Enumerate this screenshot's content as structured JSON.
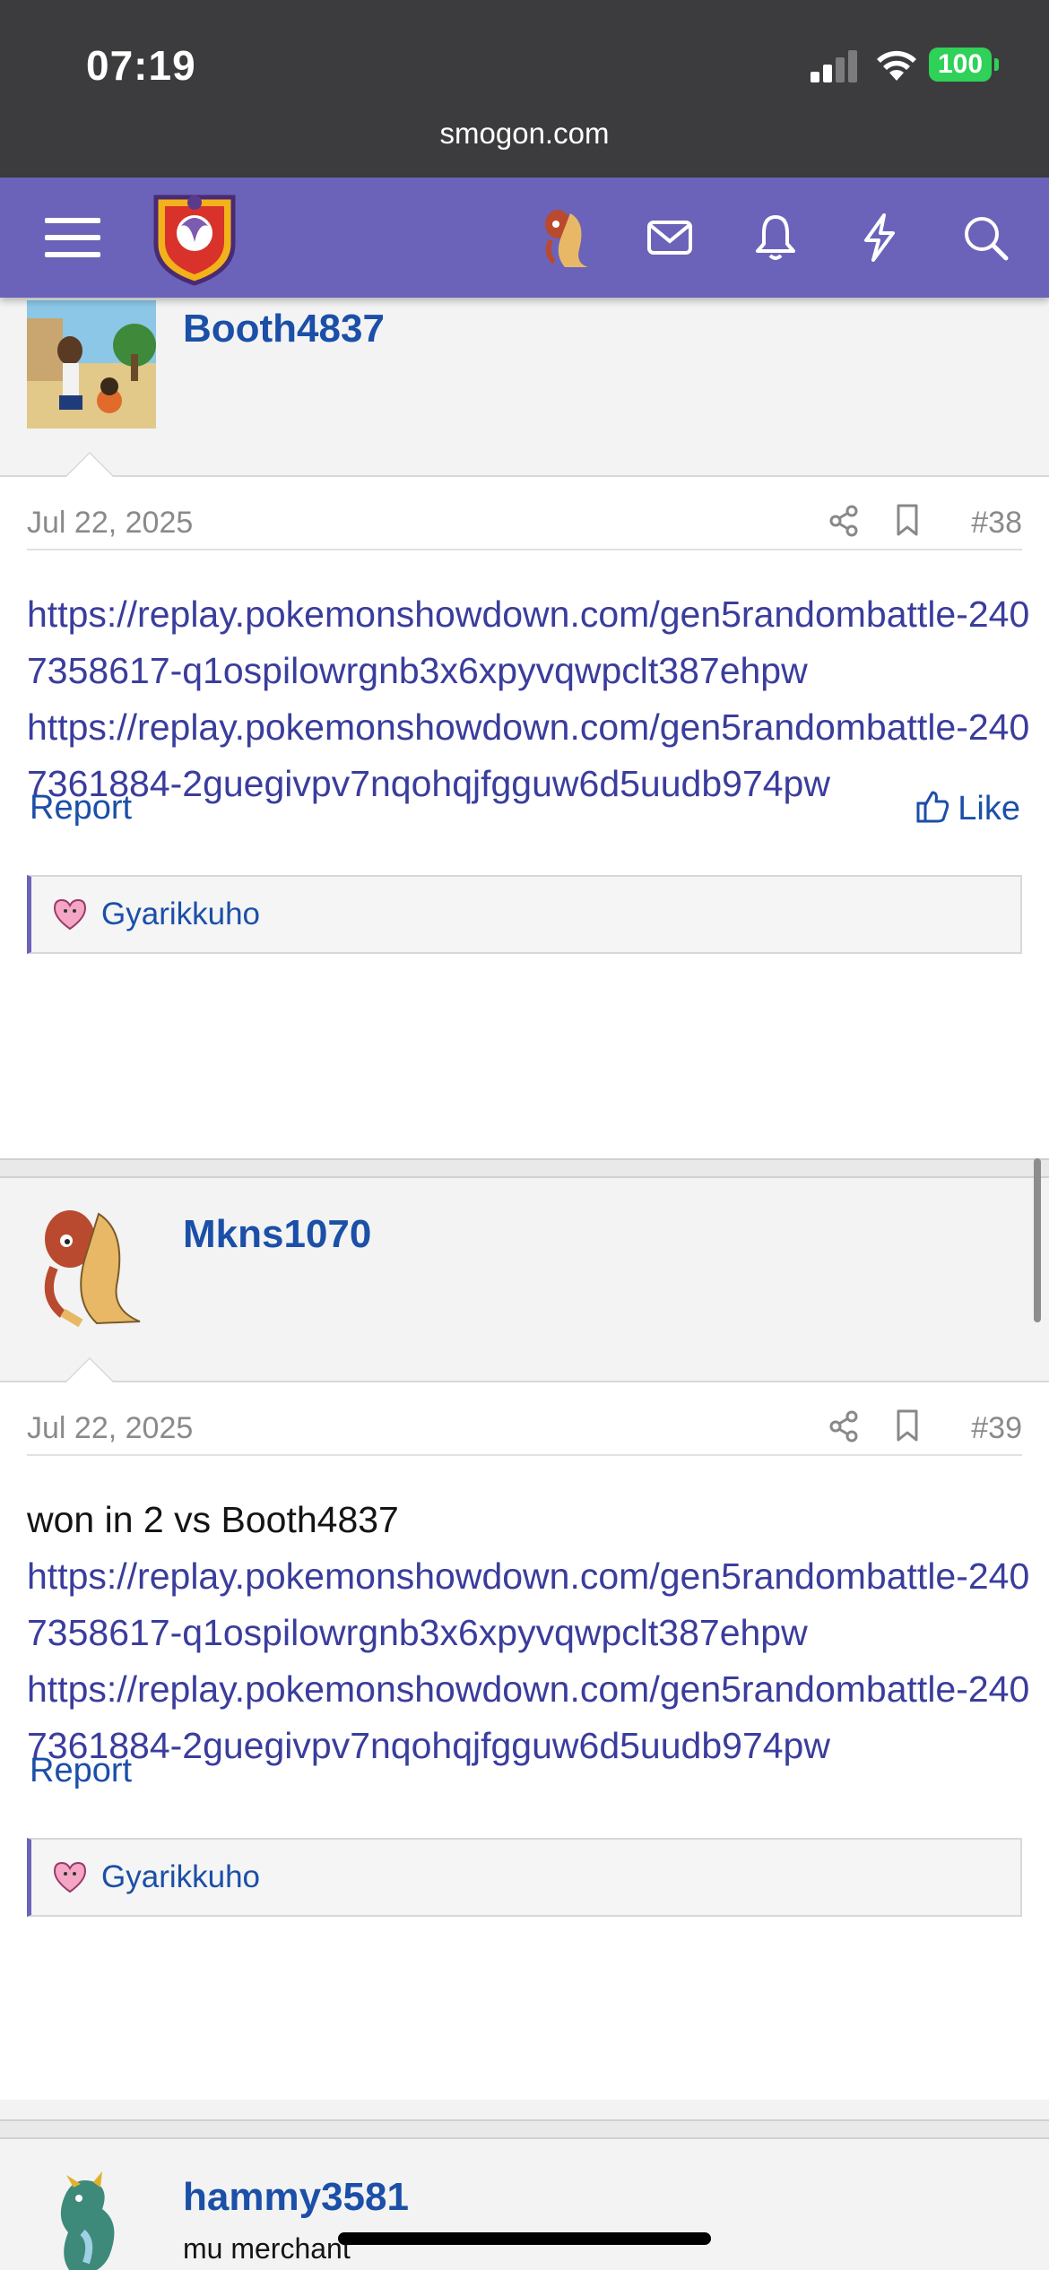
{
  "status_bar": {
    "time": "07:19",
    "battery": "100"
  },
  "browser": {
    "url": "smogon.com"
  },
  "colors": {
    "nav": "#6b63b9",
    "link": "#3a3d9c",
    "username": "#1b4fa8"
  },
  "posts": [
    {
      "author": "Booth4837",
      "date": "Jul 22, 2025",
      "number": "#38",
      "intro": "",
      "links": [
        "https://replay.pokemonshowdown.com/gen5randombattle-2407358617-q1ospilowrgnb3x6xpyvqwpclt387ehpw",
        "https://replay.pokemonshowdown.com/gen5randombattle-2407361884-2guegivpv7nqohqjfgguw6d5uudb974pw"
      ],
      "report": "Report",
      "like": "Like",
      "reaction_user": "Gyarikkuho"
    },
    {
      "author": "Mkns1070",
      "date": "Jul 22, 2025",
      "number": "#39",
      "intro": "won in 2 vs Booth4837",
      "links": [
        "https://replay.pokemonshowdown.com/gen5randombattle-2407358617-q1ospilowrgnb3x6xpyvqwpclt387ehpw",
        "https://replay.pokemonshowdown.com/gen5randombattle-2407361884-2guegivpv7nqohqjfgguw6d5uudb974pw"
      ],
      "report": "Report",
      "reaction_user": "Gyarikkuho"
    },
    {
      "author": "hammy3581",
      "title": "mu merchant"
    }
  ]
}
